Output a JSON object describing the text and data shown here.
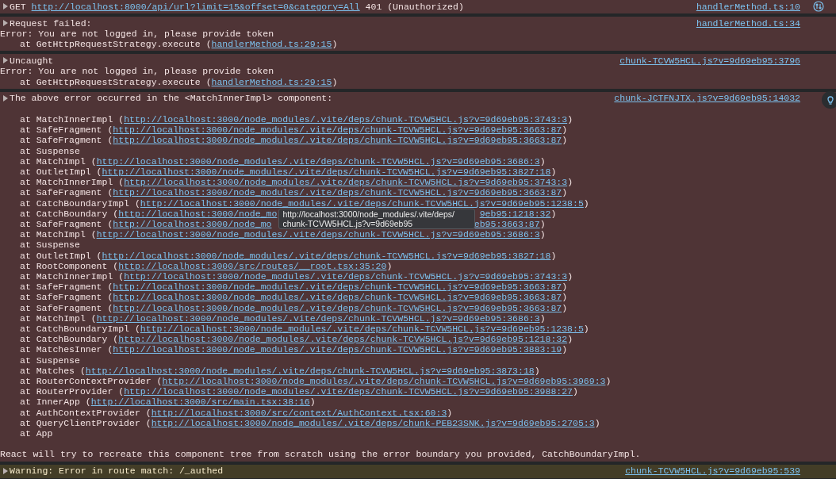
{
  "messages": [
    {
      "kind": "request",
      "summary": [
        {
          "text": "GET "
        },
        {
          "link": "http://localhost:8000/api/url?limit=15&offset=0&category=All"
        },
        {
          "text": " 401 (Unauthorized)"
        }
      ],
      "source": "handlerMethod.ts:10"
    },
    {
      "kind": "error",
      "summary": [
        {
          "text": "Request failed:"
        }
      ],
      "source": "handlerMethod.ts:34",
      "lines": [
        {
          "kind": "text",
          "parts": [
            {
              "text": "Error: You are not logged in, please provide token"
            }
          ]
        },
        {
          "kind": "frame",
          "parts": [
            {
              "text": "at GetHttpRequestStrategy.execute ("
            },
            {
              "link": "handlerMethod.ts:29:15"
            },
            {
              "text": ")"
            }
          ]
        }
      ]
    },
    {
      "kind": "error",
      "summary": [
        {
          "text": "Uncaught"
        }
      ],
      "source": "chunk-TCVW5HCL.js?v=9d69eb95:3796",
      "lines": [
        {
          "kind": "text",
          "parts": [
            {
              "text": "Error: You are not logged in, please provide token"
            }
          ]
        },
        {
          "kind": "frame",
          "parts": [
            {
              "text": "at GetHttpRequestStrategy.execute ("
            },
            {
              "link": "handlerMethod.ts:29:15"
            },
            {
              "text": ")"
            }
          ]
        }
      ]
    },
    {
      "kind": "component-error",
      "summary": [
        {
          "text": "The above error occurred in the <MatchInnerImpl> component:"
        }
      ],
      "source": "chunk-JCTFNJTX.js?v=9d69eb95:14032",
      "lines": [
        {
          "kind": "blank"
        },
        {
          "kind": "frame",
          "parts": [
            {
              "text": "at MatchInnerImpl ("
            },
            {
              "link": "http://localhost:3000/node_modules/.vite/deps/chunk-TCVW5HCL.js?v=9d69eb95:3743:3"
            },
            {
              "text": ")"
            }
          ]
        },
        {
          "kind": "frame",
          "parts": [
            {
              "text": "at SafeFragment ("
            },
            {
              "link": "http://localhost:3000/node_modules/.vite/deps/chunk-TCVW5HCL.js?v=9d69eb95:3663:87"
            },
            {
              "text": ")"
            }
          ]
        },
        {
          "kind": "frame",
          "parts": [
            {
              "text": "at SafeFragment ("
            },
            {
              "link": "http://localhost:3000/node_modules/.vite/deps/chunk-TCVW5HCL.js?v=9d69eb95:3663:87"
            },
            {
              "text": ")"
            }
          ]
        },
        {
          "kind": "frame",
          "parts": [
            {
              "text": "at Suspense"
            }
          ]
        },
        {
          "kind": "frame",
          "parts": [
            {
              "text": "at MatchImpl ("
            },
            {
              "link": "http://localhost:3000/node_modules/.vite/deps/chunk-TCVW5HCL.js?v=9d69eb95:3686:3"
            },
            {
              "text": ")"
            }
          ]
        },
        {
          "kind": "frame",
          "parts": [
            {
              "text": "at OutletImpl ("
            },
            {
              "link": "http://localhost:3000/node_modules/.vite/deps/chunk-TCVW5HCL.js?v=9d69eb95:3827:18"
            },
            {
              "text": ")"
            }
          ]
        },
        {
          "kind": "frame",
          "parts": [
            {
              "text": "at MatchInnerImpl ("
            },
            {
              "link": "http://localhost:3000/node_modules/.vite/deps/chunk-TCVW5HCL.js?v=9d69eb95:3743:3"
            },
            {
              "text": ")"
            }
          ]
        },
        {
          "kind": "frame",
          "parts": [
            {
              "text": "at SafeFragment ("
            },
            {
              "link": "http://localhost:3000/node_modules/.vite/deps/chunk-TCVW5HCL.js?v=9d69eb95:3663:87"
            },
            {
              "text": ")"
            }
          ]
        },
        {
          "kind": "frame",
          "parts": [
            {
              "text": "at CatchBoundaryImpl ("
            },
            {
              "link": "http://localhost:3000/node_modules/.vite/deps/chunk-TCVW5HCL.js?v=9d69eb95:1238:5"
            },
            {
              "text": ")"
            }
          ]
        },
        {
          "kind": "frame",
          "parts": [
            {
              "text": "at CatchBoundary ("
            },
            {
              "link": "http://localhost:3000/node_mo"
            },
            {
              "kind": "gap",
              "tooltip": [
                "http://localhost:3000/node_modules/.vite/deps/",
                "chunk-TCVW5HCL.js?v=9d69eb95"
              ]
            },
            {
              "link": "9eb95:1218:32"
            },
            {
              "text": ")"
            }
          ]
        },
        {
          "kind": "frame",
          "parts": [
            {
              "text": "at SafeFragment ("
            },
            {
              "link": "http://localhost:3000/node_mo"
            },
            {
              "kind": "gap"
            },
            {
              "link": "eb95:3663:87"
            },
            {
              "text": ")"
            }
          ]
        },
        {
          "kind": "frame",
          "parts": [
            {
              "text": "at MatchImpl ("
            },
            {
              "link": "http://localhost:3000/node_modules/.vite/deps/chunk-TCVW5HCL.js?v=9d69eb95:3686:3"
            },
            {
              "text": ")"
            }
          ]
        },
        {
          "kind": "frame",
          "parts": [
            {
              "text": "at Suspense"
            }
          ]
        },
        {
          "kind": "frame",
          "parts": [
            {
              "text": "at OutletImpl ("
            },
            {
              "link": "http://localhost:3000/node_modules/.vite/deps/chunk-TCVW5HCL.js?v=9d69eb95:3827:18"
            },
            {
              "text": ")"
            }
          ]
        },
        {
          "kind": "frame",
          "parts": [
            {
              "text": "at RootComponent ("
            },
            {
              "link": "http://localhost:3000/src/routes/__root.tsx:35:20"
            },
            {
              "text": ")"
            }
          ]
        },
        {
          "kind": "frame",
          "parts": [
            {
              "text": "at MatchInnerImpl ("
            },
            {
              "link": "http://localhost:3000/node_modules/.vite/deps/chunk-TCVW5HCL.js?v=9d69eb95:3743:3"
            },
            {
              "text": ")"
            }
          ]
        },
        {
          "kind": "frame",
          "parts": [
            {
              "text": "at SafeFragment ("
            },
            {
              "link": "http://localhost:3000/node_modules/.vite/deps/chunk-TCVW5HCL.js?v=9d69eb95:3663:87"
            },
            {
              "text": ")"
            }
          ]
        },
        {
          "kind": "frame",
          "parts": [
            {
              "text": "at SafeFragment ("
            },
            {
              "link": "http://localhost:3000/node_modules/.vite/deps/chunk-TCVW5HCL.js?v=9d69eb95:3663:87"
            },
            {
              "text": ")"
            }
          ]
        },
        {
          "kind": "frame",
          "parts": [
            {
              "text": "at SafeFragment ("
            },
            {
              "link": "http://localhost:3000/node_modules/.vite/deps/chunk-TCVW5HCL.js?v=9d69eb95:3663:87"
            },
            {
              "text": ")"
            }
          ]
        },
        {
          "kind": "frame",
          "parts": [
            {
              "text": "at MatchImpl ("
            },
            {
              "link": "http://localhost:3000/node_modules/.vite/deps/chunk-TCVW5HCL.js?v=9d69eb95:3686:3"
            },
            {
              "text": ")"
            }
          ]
        },
        {
          "kind": "frame",
          "parts": [
            {
              "text": "at CatchBoundaryImpl ("
            },
            {
              "link": "http://localhost:3000/node_modules/.vite/deps/chunk-TCVW5HCL.js?v=9d69eb95:1238:5"
            },
            {
              "text": ")"
            }
          ]
        },
        {
          "kind": "frame",
          "parts": [
            {
              "text": "at CatchBoundary ("
            },
            {
              "link": "http://localhost:3000/node_modules/.vite/deps/chunk-TCVW5HCL.js?v=9d69eb95:1218:32"
            },
            {
              "text": ")"
            }
          ]
        },
        {
          "kind": "frame",
          "parts": [
            {
              "text": "at MatchesInner ("
            },
            {
              "link": "http://localhost:3000/node_modules/.vite/deps/chunk-TCVW5HCL.js?v=9d69eb95:3883:19"
            },
            {
              "text": ")"
            }
          ]
        },
        {
          "kind": "frame",
          "parts": [
            {
              "text": "at Suspense"
            }
          ]
        },
        {
          "kind": "frame",
          "parts": [
            {
              "text": "at Matches ("
            },
            {
              "link": "http://localhost:3000/node_modules/.vite/deps/chunk-TCVW5HCL.js?v=9d69eb95:3873:18"
            },
            {
              "text": ")"
            }
          ]
        },
        {
          "kind": "frame",
          "parts": [
            {
              "text": "at RouterContextProvider ("
            },
            {
              "link": "http://localhost:3000/node_modules/.vite/deps/chunk-TCVW5HCL.js?v=9d69eb95:3969:3"
            },
            {
              "text": ")"
            }
          ]
        },
        {
          "kind": "frame",
          "parts": [
            {
              "text": "at RouterProvider ("
            },
            {
              "link": "http://localhost:3000/node_modules/.vite/deps/chunk-TCVW5HCL.js?v=9d69eb95:3988:27"
            },
            {
              "text": ")"
            }
          ]
        },
        {
          "kind": "frame",
          "parts": [
            {
              "text": "at InnerApp ("
            },
            {
              "link": "http://localhost:3000/src/main.tsx:38:16"
            },
            {
              "text": ")"
            }
          ]
        },
        {
          "kind": "frame",
          "parts": [
            {
              "text": "at AuthContextProvider ("
            },
            {
              "link": "http://localhost:3000/src/context/AuthContext.tsx:60:3"
            },
            {
              "text": ")"
            }
          ]
        },
        {
          "kind": "frame",
          "parts": [
            {
              "text": "at QueryClientProvider ("
            },
            {
              "link": "http://localhost:3000/node_modules/.vite/deps/chunk-PEB23SNK.js?v=9d69eb95:2705:3"
            },
            {
              "text": ")"
            }
          ]
        },
        {
          "kind": "frame",
          "parts": [
            {
              "text": "at App"
            }
          ]
        },
        {
          "kind": "blank"
        },
        {
          "kind": "text",
          "parts": [
            {
              "text": "React will try to recreate this component tree from scratch using the error boundary you provided, CatchBoundaryImpl."
            }
          ]
        }
      ]
    },
    {
      "kind": "warning",
      "summary": [
        {
          "text": "Warning: Error in route match: /_authed"
        }
      ],
      "source": "chunk-TCVW5HCL.js?v=9d69eb95:539"
    }
  ]
}
